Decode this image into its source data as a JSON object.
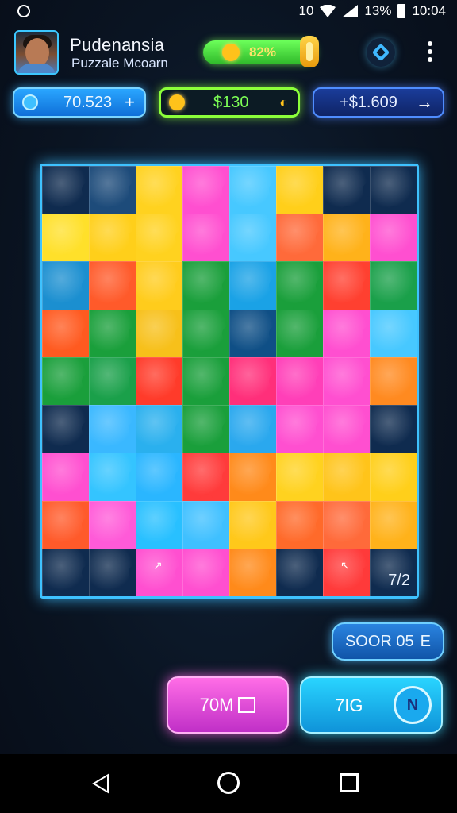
{
  "status_bar": {
    "signal_text": "10",
    "battery_text": "13%",
    "time": "10:04"
  },
  "header": {
    "player_name": "Pudenansia",
    "subtitle": "Puzzale Mcoarn",
    "coin_progress": "82%"
  },
  "stats": {
    "gems": "70.523",
    "coins": "$130",
    "cash": "$1.609",
    "add_symbol": "+",
    "cash_prefix": "+",
    "arrow_symbol": "→"
  },
  "board": {
    "progress_label": "7/2",
    "columns": 8,
    "rows": 9,
    "pieces": [
      "#0f2b4f",
      "#1d4b7a",
      "#ffd21f",
      "#ff4fd0",
      "#47c8ff",
      "#ffcf1a",
      "#0f2b4f",
      "#0f2b4f",
      "#ffe02a",
      "#ffcf1a",
      "#ffd21f",
      "#ff4fd0",
      "#47c8ff",
      "#ff6a3a",
      "#ffb21a",
      "#ff4fd0",
      "#1b8fd0",
      "#ff5a2a",
      "#ffcc1c",
      "#1a9f3b",
      "#1aa2e6",
      "#1a9f3b",
      "#ff4030",
      "#1aa04a",
      "#ff5a20",
      "#1a9f3b",
      "#f7c01a",
      "#1a9f3b",
      "#0f4f86",
      "#1a9f3b",
      "#ff4fd0",
      "#47c8ff",
      "#1a9f3b",
      "#1aa04a",
      "#ff3b2a",
      "#1a9f3b",
      "#ff2f7a",
      "#ff3fb8",
      "#ff4fd0",
      "#ff8a20",
      "#0f2b4f",
      "#3ab8ff",
      "#2ab0ee",
      "#1a9f3b",
      "#2aa8ee",
      "#ff4fd0",
      "#ff4fd0",
      "#0f2b4f",
      "#ff4fd0",
      "#34c4ff",
      "#2ab6ff",
      "#ff3b3b",
      "#ff8a1a",
      "#ffd21f",
      "#ffc41a",
      "#ffcf1a",
      "#ff5a2a",
      "#ff5ad8",
      "#28c0ff",
      "#3fc0ff",
      "#ffc81a",
      "#ff6a2a",
      "#ff6a3a",
      "#ffb21a",
      "#0f2b4f",
      "#0f2b4f",
      "#ff4fd0",
      "#ff4fd0",
      "#ff8a1a",
      "#0f2b4f",
      "#ff3a3a",
      "#0f2b4f"
    ]
  },
  "buttons": {
    "side_label": "SOOR 05",
    "side_icon_text": "E",
    "pink_label": "70M",
    "cyan_label": "7IG",
    "cyan_icon_text": "N"
  },
  "colors": {
    "accent_blue": "#3ec2ff",
    "accent_green": "#8cff3a",
    "accent_pink": "#ff6de6",
    "background": "#0b1626"
  }
}
